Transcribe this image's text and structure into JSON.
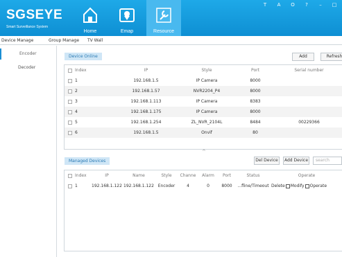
{
  "header": {
    "brand": "SGSEYE",
    "brand_sub": "Smart Surveillance System",
    "nav": [
      {
        "label": "Home",
        "icon": "home-icon"
      },
      {
        "label": "Emap",
        "icon": "map-pin-icon"
      },
      {
        "label": "Resource",
        "icon": "wrench-icon"
      }
    ],
    "window_controls": [
      "T",
      "A",
      "O",
      "?",
      "–",
      "□"
    ]
  },
  "subtabs": [
    "Device Manage",
    "Group Manage",
    "TV Wall"
  ],
  "sidebar": [
    "Encoder",
    "Decoder"
  ],
  "online": {
    "tag": "Device Online",
    "add_label": "Add",
    "refresh_label": "Refresh",
    "columns": [
      "Index",
      "IP",
      "Style",
      "Port",
      "Serial number"
    ],
    "rows": [
      {
        "index": "1",
        "ip": "192.168.1.5",
        "style": "IP Camera",
        "port": "8000",
        "serial": ""
      },
      {
        "index": "2",
        "ip": "192.168.1.57",
        "style": "NVR2204_P4",
        "port": "8000",
        "serial": ""
      },
      {
        "index": "3",
        "ip": "192.168.1.113",
        "style": "IP Camera",
        "port": "8383",
        "serial": ""
      },
      {
        "index": "4",
        "ip": "192.168.1.175",
        "style": "IP Camera",
        "port": "8000",
        "serial": ""
      },
      {
        "index": "5",
        "ip": "192.168.1.254",
        "style": "ZL_NVR_2104L",
        "port": "8484",
        "serial": "00229366"
      },
      {
        "index": "6",
        "ip": "192.168.1.5",
        "style": "Onvif",
        "port": "80",
        "serial": ""
      }
    ]
  },
  "managed": {
    "tag": "Managed Devices",
    "del_label": "Del Device",
    "add_label": "Add Device",
    "search_placeholder": "search",
    "columns": [
      "Index",
      "IP",
      "Name",
      "Style",
      "Channe",
      "Alarm",
      "Port",
      "Status",
      "Operate"
    ],
    "rows": [
      {
        "index": "1",
        "ip": "192.168.1.122",
        "name": "192.168.1.122",
        "style": "Encoder",
        "channel": "4",
        "alarm": "0",
        "port": "8000",
        "status": "...fline/Timeout",
        "delete": "Delete",
        "modify": "Modify",
        "operate": "Operate"
      }
    ]
  }
}
